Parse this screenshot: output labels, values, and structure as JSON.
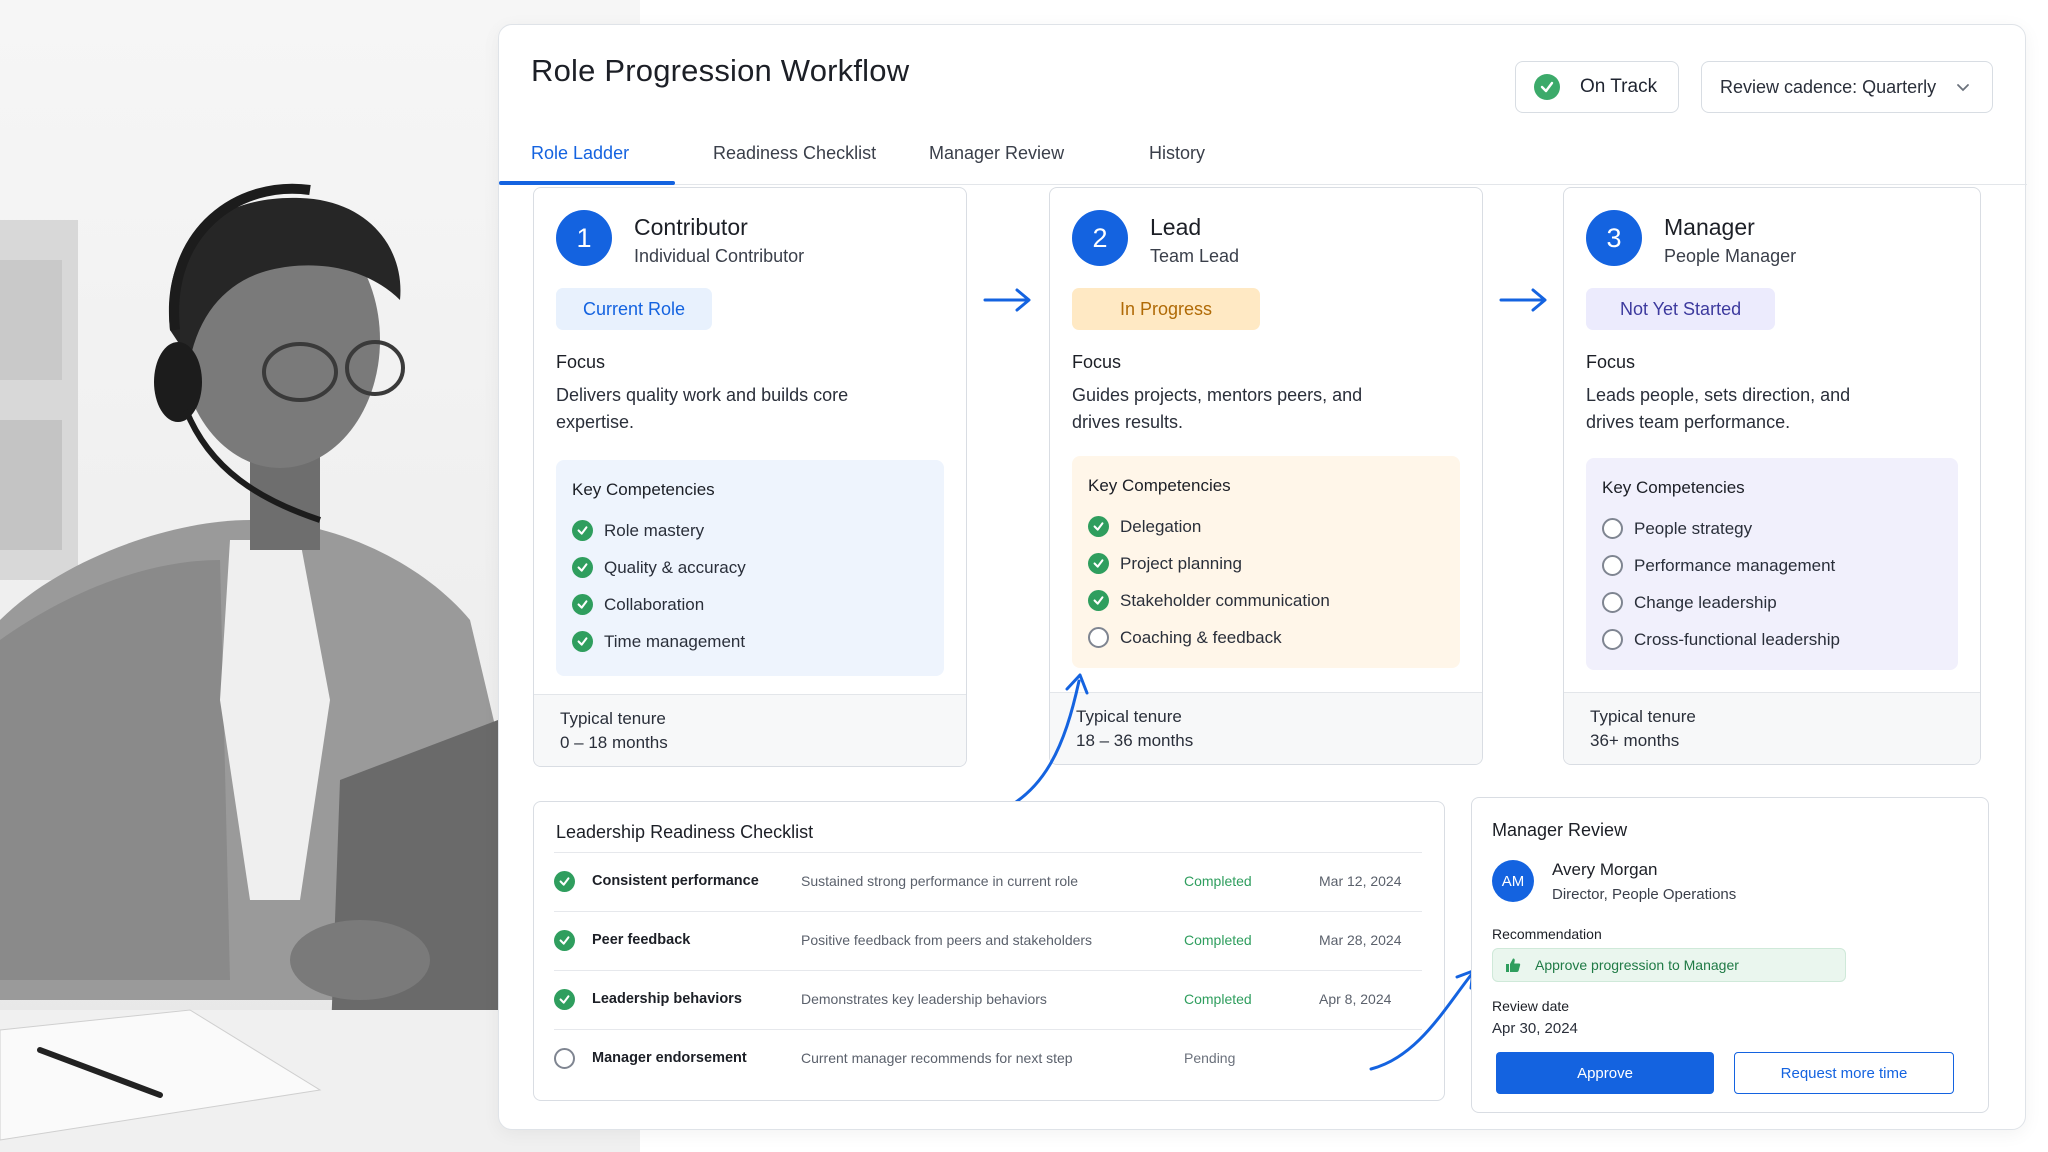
{
  "header": {
    "title": "Role Progression Workflow",
    "status": "On Track",
    "cadence": "Review cadence: Quarterly"
  },
  "tabs": [
    {
      "label": "Role Ladder",
      "active": true
    },
    {
      "label": "Readiness Checklist",
      "active": false
    },
    {
      "label": "Manager Review",
      "active": false
    },
    {
      "label": "History",
      "active": false
    }
  ],
  "roles": [
    {
      "number": "1",
      "name": "Contributor",
      "subtitle": "Individual Contributor",
      "badge": "Current Role",
      "focus_label": "Focus",
      "focus": "Delivers quality work and builds core expertise.",
      "competencies_label": "Key Competencies",
      "competencies": [
        {
          "label": "Role mastery",
          "done": true
        },
        {
          "label": "Quality & accuracy",
          "done": true
        },
        {
          "label": "Collaboration",
          "done": true
        },
        {
          "label": "Time management",
          "done": true
        }
      ],
      "tenure_label": "Typical tenure",
      "tenure": "0 – 18 months"
    },
    {
      "number": "2",
      "name": "Lead",
      "subtitle": "Team Lead",
      "badge": "In Progress",
      "focus_label": "Focus",
      "focus": "Guides projects, mentors peers, and drives results.",
      "competencies_label": "Key Competencies",
      "competencies": [
        {
          "label": "Delegation",
          "done": true
        },
        {
          "label": "Project planning",
          "done": true
        },
        {
          "label": "Stakeholder communication",
          "done": true
        },
        {
          "label": "Coaching & feedback",
          "done": false
        }
      ],
      "tenure_label": "Typical tenure",
      "tenure": "18 – 36 months"
    },
    {
      "number": "3",
      "name": "Manager",
      "subtitle": "People Manager",
      "badge": "Not Yet Started",
      "focus_label": "Focus",
      "focus": "Leads people, sets direction, and drives team performance.",
      "competencies_label": "Key Competencies",
      "competencies": [
        {
          "label": "People strategy",
          "done": false
        },
        {
          "label": "Performance management",
          "done": false
        },
        {
          "label": "Change leadership",
          "done": false
        },
        {
          "label": "Cross-functional leadership",
          "done": false
        }
      ],
      "tenure_label": "Typical tenure",
      "tenure": "36+ months"
    }
  ],
  "checklist": {
    "title": "Leadership Readiness Checklist",
    "rows": [
      {
        "name": "Consistent performance",
        "desc": "Sustained strong performance in current role",
        "status": "Completed",
        "date": "Mar 12, 2024",
        "done": true
      },
      {
        "name": "Peer feedback",
        "desc": "Positive feedback from peers and stakeholders",
        "status": "Completed",
        "date": "Mar 28, 2024",
        "done": true
      },
      {
        "name": "Leadership behaviors",
        "desc": "Demonstrates key leadership behaviors",
        "status": "Completed",
        "date": "Apr 8, 2024",
        "done": true
      },
      {
        "name": "Manager endorsement",
        "desc": "Current manager recommends for next step",
        "status": "Pending",
        "date": "",
        "done": false
      }
    ]
  },
  "review": {
    "title": "Manager Review",
    "initials": "AM",
    "name": "Avery Morgan",
    "role": "Director, People Operations",
    "recommendation_label": "Recommendation",
    "recommendation": "Approve progression to Manager",
    "date_label": "Review date",
    "date": "Apr 30, 2024",
    "approve_label": "Approve",
    "more_time_label": "Request more time"
  },
  "colors": {
    "accent": "#1463e0",
    "success": "#2f9e5e",
    "in_progress": "#b06a06",
    "not_started": "#3d3a9e"
  }
}
